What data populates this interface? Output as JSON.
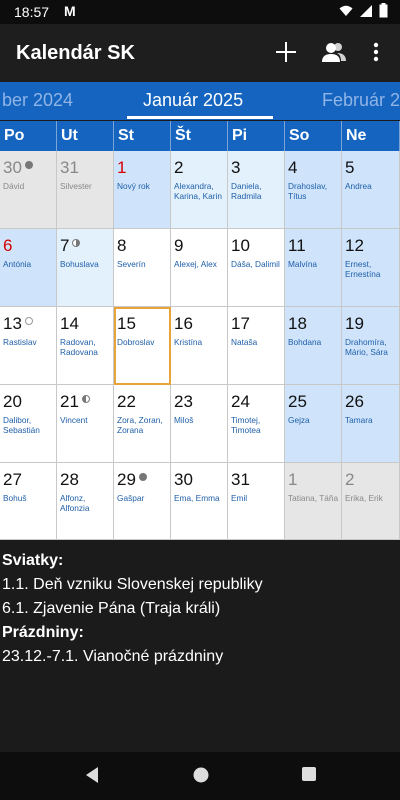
{
  "status_bar": {
    "time": "18:57",
    "mail_icon": "M"
  },
  "app_bar": {
    "title": "Kalendár SK",
    "add_icon": "plus-icon",
    "contacts_icon": "contacts-icon",
    "menu_icon": "more-vert-icon"
  },
  "months": {
    "prev": "ber 2024",
    "current": "Január 2025",
    "next": "Február 2"
  },
  "days": [
    "Po",
    "Ut",
    "St",
    "Št",
    "Pi",
    "So",
    "Ne"
  ],
  "weeks": [
    [
      {
        "num": "30",
        "names": "Dávid",
        "type": "other",
        "moon": "full"
      },
      {
        "num": "31",
        "names": "Silvester",
        "type": "other"
      },
      {
        "num": "1",
        "names": "Nový rok",
        "type": "holiday",
        "red": true
      },
      {
        "num": "2",
        "names": "Alexandra, Karina, Karin",
        "type": "light"
      },
      {
        "num": "3",
        "names": "Daniela, Radmila",
        "type": "light"
      },
      {
        "num": "4",
        "names": "Drahoslav, Títus",
        "type": "weekend"
      },
      {
        "num": "5",
        "names": "Andrea",
        "type": "weekend"
      }
    ],
    [
      {
        "num": "6",
        "names": "Antónia",
        "type": "holiday",
        "red": true
      },
      {
        "num": "7",
        "names": "Bohuslava",
        "type": "light",
        "moon": "half-r"
      },
      {
        "num": "8",
        "names": "Severín",
        "type": "normal"
      },
      {
        "num": "9",
        "names": "Alexej, Alex",
        "type": "normal"
      },
      {
        "num": "10",
        "names": "Dáša, Dalimil",
        "type": "normal"
      },
      {
        "num": "11",
        "names": "Malvína",
        "type": "weekend"
      },
      {
        "num": "12",
        "names": "Ernest, Ernestína",
        "type": "weekend"
      }
    ],
    [
      {
        "num": "13",
        "names": "Rastislav",
        "type": "normal",
        "moon": "new"
      },
      {
        "num": "14",
        "names": "Radovan, Radovana",
        "type": "normal"
      },
      {
        "num": "15",
        "names": "Dobroslav",
        "type": "normal",
        "today": true
      },
      {
        "num": "16",
        "names": "Kristína",
        "type": "normal"
      },
      {
        "num": "17",
        "names": "Nataša",
        "type": "normal"
      },
      {
        "num": "18",
        "names": "Bohdana",
        "type": "weekend"
      },
      {
        "num": "19",
        "names": "Drahomíra, Mário, Sára",
        "type": "weekend"
      }
    ],
    [
      {
        "num": "20",
        "names": "Dalibor, Sebastián",
        "type": "normal"
      },
      {
        "num": "21",
        "names": "Vincent",
        "type": "normal",
        "moon": "half-l"
      },
      {
        "num": "22",
        "names": "Zora, Zoran, Zorana",
        "type": "normal"
      },
      {
        "num": "23",
        "names": "Miloš",
        "type": "normal"
      },
      {
        "num": "24",
        "names": "Timotej, Timotea",
        "type": "normal"
      },
      {
        "num": "25",
        "names": "Gejza",
        "type": "weekend"
      },
      {
        "num": "26",
        "names": "Tamara",
        "type": "weekend"
      }
    ],
    [
      {
        "num": "27",
        "names": "Bohuš",
        "type": "normal"
      },
      {
        "num": "28",
        "names": "Alfonz, Alfonzia",
        "type": "normal"
      },
      {
        "num": "29",
        "names": "Gašpar",
        "type": "normal",
        "moon": "full"
      },
      {
        "num": "30",
        "names": "Ema, Emma",
        "type": "normal"
      },
      {
        "num": "31",
        "names": "Emil",
        "type": "normal"
      },
      {
        "num": "1",
        "names": "Tatiana, Táňa",
        "type": "other"
      },
      {
        "num": "2",
        "names": "Erika, Erik",
        "type": "other"
      }
    ]
  ],
  "info": {
    "holidays_heading": "Sviatky:",
    "holidays": [
      "1.1. Deň vzniku Slovenskej republiky",
      "6.1. Zjavenie Pána (Traja králi)"
    ],
    "vacations_heading": "Prázdniny:",
    "vacations": [
      "23.12.-7.1. Vianočné prázdniny"
    ]
  },
  "nav": {
    "back_icon": "back-icon",
    "home_icon": "home-icon",
    "recents_icon": "recents-icon"
  },
  "colors": {
    "accent": "#1565c0",
    "weekend": "#cfe4fb",
    "other_month": "#e6e6e6",
    "today_border": "#e8a33a",
    "holiday_red": "#d40000"
  }
}
